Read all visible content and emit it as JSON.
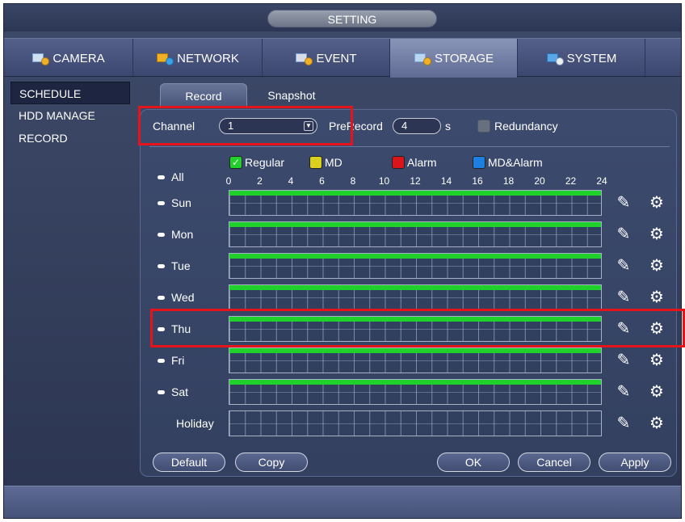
{
  "window": {
    "title": "SETTING"
  },
  "main_tabs": [
    {
      "label": "CAMERA",
      "icon": "camera-icon"
    },
    {
      "label": "NETWORK",
      "icon": "network-icon"
    },
    {
      "label": "EVENT",
      "icon": "event-icon"
    },
    {
      "label": "STORAGE",
      "icon": "storage-icon",
      "active": true
    },
    {
      "label": "SYSTEM",
      "icon": "system-icon"
    }
  ],
  "sidebar": {
    "items": [
      {
        "label": "SCHEDULE",
        "active": true
      },
      {
        "label": "HDD MANAGE"
      },
      {
        "label": "RECORD"
      }
    ]
  },
  "sub_tabs": [
    {
      "label": "Record",
      "active": true
    },
    {
      "label": "Snapshot"
    }
  ],
  "form": {
    "channel_label": "Channel",
    "channel_value": "1",
    "prerecord_label": "PreRecord",
    "prerecord_value": "4",
    "prerecord_unit": "s",
    "redundancy_label": "Redundancy",
    "redundancy_checked": false
  },
  "legend": [
    {
      "label": "Regular",
      "color": "#1fd12a",
      "checked": true
    },
    {
      "label": "MD",
      "color": "#d8cf1f"
    },
    {
      "label": "Alarm",
      "color": "#d9141a"
    },
    {
      "label": "MD&Alarm",
      "color": "#1d7fe0"
    }
  ],
  "all_label": "All",
  "hours": [
    "0",
    "2",
    "4",
    "6",
    "8",
    "10",
    "12",
    "14",
    "16",
    "18",
    "20",
    "22",
    "24"
  ],
  "days": [
    {
      "label": "Sun",
      "regular_fraction": 1.0
    },
    {
      "label": "Mon",
      "regular_fraction": 1.0
    },
    {
      "label": "Tue",
      "regular_fraction": 1.0
    },
    {
      "label": "Wed",
      "regular_fraction": 1.0
    },
    {
      "label": "Thu",
      "regular_fraction": 1.0
    },
    {
      "label": "Fri",
      "regular_fraction": 1.0
    },
    {
      "label": "Sat",
      "regular_fraction": 1.0
    },
    {
      "label": "Holiday",
      "regular_fraction": 0
    }
  ],
  "buttons": {
    "default": "Default",
    "copy": "Copy",
    "ok": "OK",
    "cancel": "Cancel",
    "apply": "Apply"
  },
  "colors": {
    "highlight": "#e4141a",
    "regular": "#1fd12a"
  }
}
